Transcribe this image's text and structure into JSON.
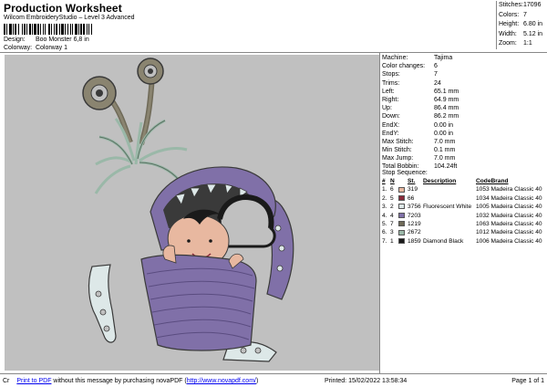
{
  "header": {
    "title": "Production Worksheet",
    "subtitle": "Wilcom EmbroideryStudio – Level 3 Advanced",
    "design_label": "Design:",
    "design_value": "Boo Monster 6,8 in",
    "colorway_label": "Colorway:",
    "colorway_value": "Colorway 1"
  },
  "stats": [
    {
      "label": "Stitches:",
      "value": "17096"
    },
    {
      "label": "Colors:",
      "value": "7"
    },
    {
      "label": "Height:",
      "value": "6.80 in"
    },
    {
      "label": "Width:",
      "value": "5.12 in"
    },
    {
      "label": "Zoom:",
      "value": "1:1"
    }
  ],
  "params": [
    {
      "label": "Machine:",
      "value": "Tajima"
    },
    {
      "label": "Color changes:",
      "value": "6"
    },
    {
      "label": "Stops:",
      "value": "7"
    },
    {
      "label": "Trims:",
      "value": "24"
    },
    {
      "label": "Left:",
      "value": "65.1 mm"
    },
    {
      "label": "Right:",
      "value": "64.9 mm"
    },
    {
      "label": "Up:",
      "value": "86.4 mm"
    },
    {
      "label": "Down:",
      "value": "86.2 mm"
    },
    {
      "label": "EndX:",
      "value": "0.00 in"
    },
    {
      "label": "EndY:",
      "value": "0.00 in"
    },
    {
      "label": "Max Stitch:",
      "value": "7.0 mm"
    },
    {
      "label": "Min Stitch:",
      "value": "0.1 mm"
    },
    {
      "label": "Max Jump:",
      "value": "7.0 mm"
    },
    {
      "label": "Total Bobbin:",
      "value": "104.24ft"
    }
  ],
  "sequence": {
    "caption": "Stop Sequence:",
    "headers": {
      "num": "#",
      "n": "N",
      "st": "St.",
      "desc": "Description",
      "code": "Code",
      "brand": "Brand"
    },
    "rows": [
      {
        "num": "1.",
        "n": "6",
        "color": "#e8b8a0",
        "st": "319",
        "desc": "",
        "code": "1053",
        "brand": "Madeira Classic 40"
      },
      {
        "num": "2.",
        "n": "5",
        "color": "#8a2a3a",
        "st": "66",
        "desc": "",
        "code": "1034",
        "brand": "Madeira Classic 40"
      },
      {
        "num": "3.",
        "n": "2",
        "color": "#dde8e8",
        "st": "3756",
        "desc": "Fluorescent White",
        "code": "1005",
        "brand": "Madeira Classic 40"
      },
      {
        "num": "4.",
        "n": "4",
        "color": "#8070a8",
        "st": "7203",
        "desc": "",
        "code": "1032",
        "brand": "Madeira Classic 40"
      },
      {
        "num": "5.",
        "n": "7",
        "color": "#6f6a58",
        "st": "1219",
        "desc": "",
        "code": "1063",
        "brand": "Madeira Classic 40"
      },
      {
        "num": "6.",
        "n": "3",
        "color": "#9ab8a8",
        "st": "2672",
        "desc": "",
        "code": "1012",
        "brand": "Madeira Classic 40"
      },
      {
        "num": "7.",
        "n": "1",
        "color": "#1a1a1a",
        "st": "1859",
        "desc": "Diamond Black",
        "code": "1006",
        "brand": "Madeira Classic 40"
      }
    ]
  },
  "footer": {
    "cut_text": "Cr",
    "print_link": "Print to PDF",
    "message": " without this message by purchasing novaPDF (",
    "url": "http://www.novapdf.com/",
    "close_paren": ")",
    "printed": "Printed: 15/02/2022 13:58:34",
    "page": "Page 1 of 1"
  },
  "colors": {
    "canvas": "#c0c0c0",
    "purple": "#8070a8",
    "outline": "#3a3a3a",
    "olive": "#8a8470",
    "mint": "#9ab8a8",
    "white_thread": "#dde8e8",
    "skin": "#e8b8a0",
    "black": "#1a1a1a"
  }
}
